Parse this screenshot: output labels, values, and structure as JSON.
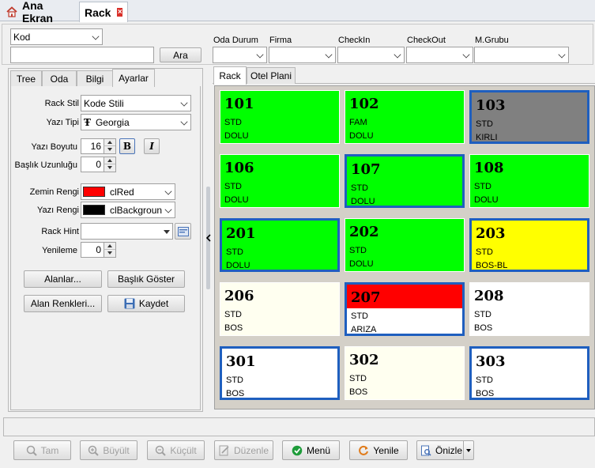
{
  "tabs": {
    "home": "Ana Ekran",
    "rack": "Rack",
    "close": "×"
  },
  "search": {
    "field_select": "Kod",
    "query_value": "",
    "search_button": "Ara",
    "filters": [
      {
        "label": "Oda Durum",
        "value": ""
      },
      {
        "label": "Firma",
        "value": ""
      },
      {
        "label": "CheckIn",
        "value": ""
      },
      {
        "label": "CheckOut",
        "value": ""
      },
      {
        "label": "M.Grubu",
        "value": ""
      }
    ]
  },
  "left_tabs": [
    "Tree",
    "Oda",
    "Bilgi",
    "Ayarlar"
  ],
  "settings": {
    "rack_stil_label": "Rack Stil",
    "rack_stil_value": "Kode Stili",
    "yazi_tipi_label": "Yazı Tipi",
    "yazi_tipi_value": "Georgia",
    "font_icon_glyph": "Ŧ",
    "yazi_boyutu_label": "Yazı Boyutu",
    "yazi_boyutu_value": "16",
    "bold_label": "B",
    "italic_label": "I",
    "baslik_uzunlugu_label": "Başlık Uzunluğu",
    "baslik_uzunlugu_value": "0",
    "zemin_rengi_label": "Zemin Rengi",
    "zemin_rengi_value": "clRed",
    "zemin_color": "#ff0000",
    "yazi_rengi_label": "Yazı Rengi",
    "yazi_rengi_value": "clBackgroun",
    "yazi_color": "#000000",
    "rack_hint_label": "Rack Hint",
    "rack_hint_value": "",
    "yenileme_label": "Yenileme",
    "yenileme_value": "0",
    "alanlar_button": "Alanlar...",
    "baslik_goster_button": "Başlık Göster",
    "alan_renkleri_button": "Alan Renkleri...",
    "kaydet_button": "Kaydet"
  },
  "right_tabs": [
    "Rack",
    "Otel Plani"
  ],
  "colors": {
    "green": "#00ff00",
    "gray": "#808080",
    "yellow": "#ffff00",
    "white": "#ffffff",
    "red": "#ff0000",
    "cream": "#fffff0",
    "selected_border": "#1f5fbf"
  },
  "rooms": [
    {
      "num": "101",
      "type": "STD",
      "status": "DOLU",
      "color": "green",
      "selected": false
    },
    {
      "num": "102",
      "type": "FAM",
      "status": "DOLU",
      "color": "green",
      "selected": false
    },
    {
      "num": "103",
      "type": "STD",
      "status": "KIRLI",
      "color": "gray",
      "selected": true
    },
    {
      "num": "106",
      "type": "STD",
      "status": "DOLU",
      "color": "green",
      "selected": false
    },
    {
      "num": "107",
      "type": "STD",
      "status": "DOLU",
      "color": "green",
      "selected": true
    },
    {
      "num": "108",
      "type": "STD",
      "status": "DOLU",
      "color": "green",
      "selected": false
    },
    {
      "num": "201",
      "type": "STD",
      "status": "DOLU",
      "color": "green",
      "selected": true
    },
    {
      "num": "202",
      "type": "STD",
      "status": "DOLU",
      "color": "green",
      "selected": false
    },
    {
      "num": "203",
      "type": "STD",
      "status": "BOS-BL",
      "color": "yellow",
      "selected": true
    },
    {
      "num": "206",
      "type": "STD",
      "status": "BOS",
      "color": "cream",
      "selected": false
    },
    {
      "num": "207",
      "type": "STD",
      "status": "ARIZA",
      "color": "red-header",
      "selected": true
    },
    {
      "num": "208",
      "type": "STD",
      "status": "BOS",
      "color": "white",
      "selected": false
    },
    {
      "num": "301",
      "type": "STD",
      "status": "BOS",
      "color": "white",
      "selected": true
    },
    {
      "num": "302",
      "type": "STD",
      "status": "BOS",
      "color": "cream",
      "selected": false
    },
    {
      "num": "303",
      "type": "STD",
      "status": "BOS",
      "color": "white",
      "selected": true
    }
  ],
  "bottom_buttons": {
    "tam": "Tam",
    "buyult": "Büyült",
    "kucult": "Küçült",
    "duzenle": "Düzenle",
    "menu": "Menü",
    "yenile": "Yenile",
    "onizle": "Önizle"
  }
}
